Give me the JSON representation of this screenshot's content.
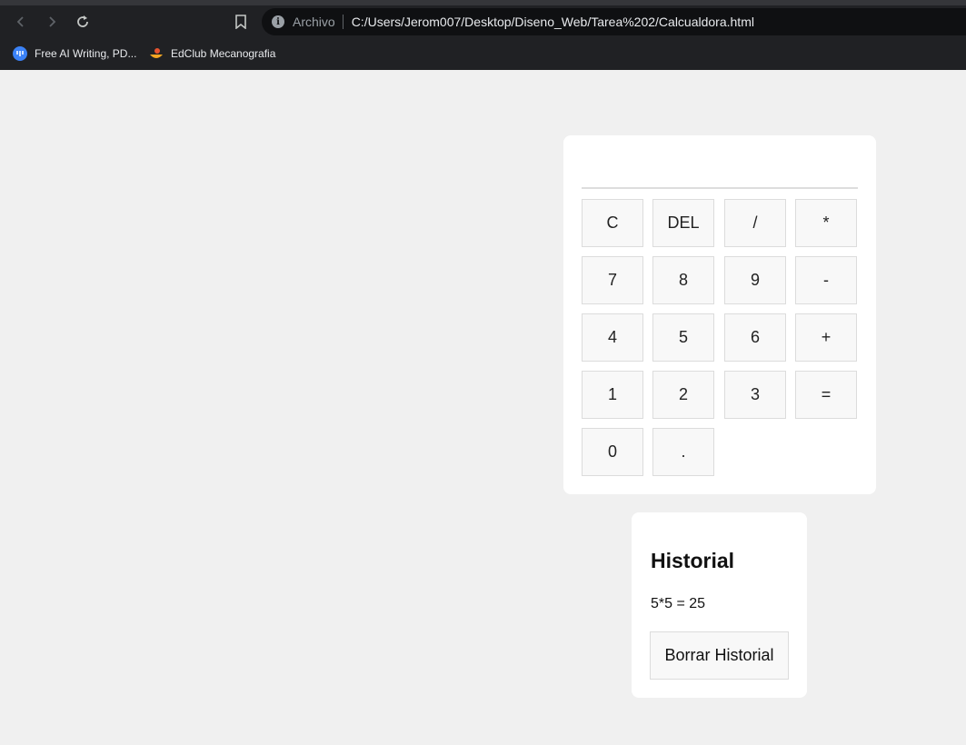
{
  "browser": {
    "scheme_label": "Archivo",
    "url": "C:/Users/Jerom007/Desktop/Diseno_Web/Tarea%202/Calcualdora.html",
    "bookmarks": [
      {
        "label": "Free AI Writing, PD...",
        "icon": "ai-writing-icon"
      },
      {
        "label": "EdClub Mecanografia",
        "icon": "edclub-icon"
      }
    ]
  },
  "calculator": {
    "display_value": "",
    "keys": [
      [
        "C",
        "DEL",
        "/",
        "*"
      ],
      [
        "7",
        "8",
        "9",
        "-"
      ],
      [
        "4",
        "5",
        "6",
        "+"
      ],
      [
        "1",
        "2",
        "3",
        "="
      ],
      [
        "0",
        "."
      ]
    ]
  },
  "history": {
    "title": "Historial",
    "entries": [
      "5*5 = 25"
    ],
    "clear_label": "Borrar Historial"
  },
  "colors": {
    "page_bg": "#f0f0f0",
    "card_bg": "#ffffff",
    "key_bg": "#f8f8f8",
    "key_border": "#dcdcdc",
    "chrome_bg": "#202124"
  }
}
